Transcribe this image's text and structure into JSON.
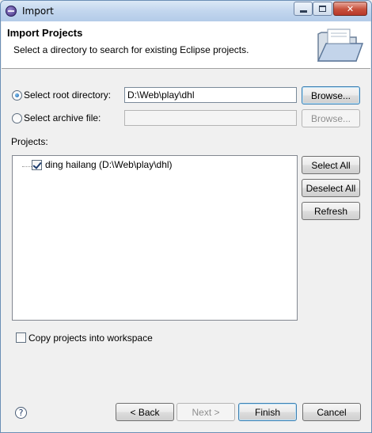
{
  "window": {
    "title": "Import",
    "minimize_label": "Minimize",
    "maximize_label": "Maximize",
    "close_label": "Close"
  },
  "banner": {
    "title": "Import Projects",
    "description": "Select a directory to search for existing Eclipse projects.",
    "icon": "folder-icon"
  },
  "root_dir": {
    "label": "Select root directory:",
    "selected": true,
    "value": "D:\\Web\\play\\dhl",
    "browse_label": "Browse..."
  },
  "archive": {
    "label": "Select archive file:",
    "selected": false,
    "value": "",
    "browse_label": "Browse..."
  },
  "projects": {
    "label": "Projects:",
    "items": [
      {
        "label": "ding hailang (D:\\Web\\play\\dhl)",
        "checked": true
      }
    ],
    "select_all_label": "Select All",
    "deselect_all_label": "Deselect All",
    "refresh_label": "Refresh"
  },
  "copy_option": {
    "label": "Copy projects into workspace",
    "checked": false
  },
  "footer": {
    "help_icon": "help-icon",
    "back_label": "< Back",
    "next_label": "Next >",
    "finish_label": "Finish",
    "cancel_label": "Cancel"
  },
  "colors": {
    "titlebar": "#c2d6ee",
    "close_button": "#c7503b",
    "focus_border": "#3c7fb1"
  }
}
